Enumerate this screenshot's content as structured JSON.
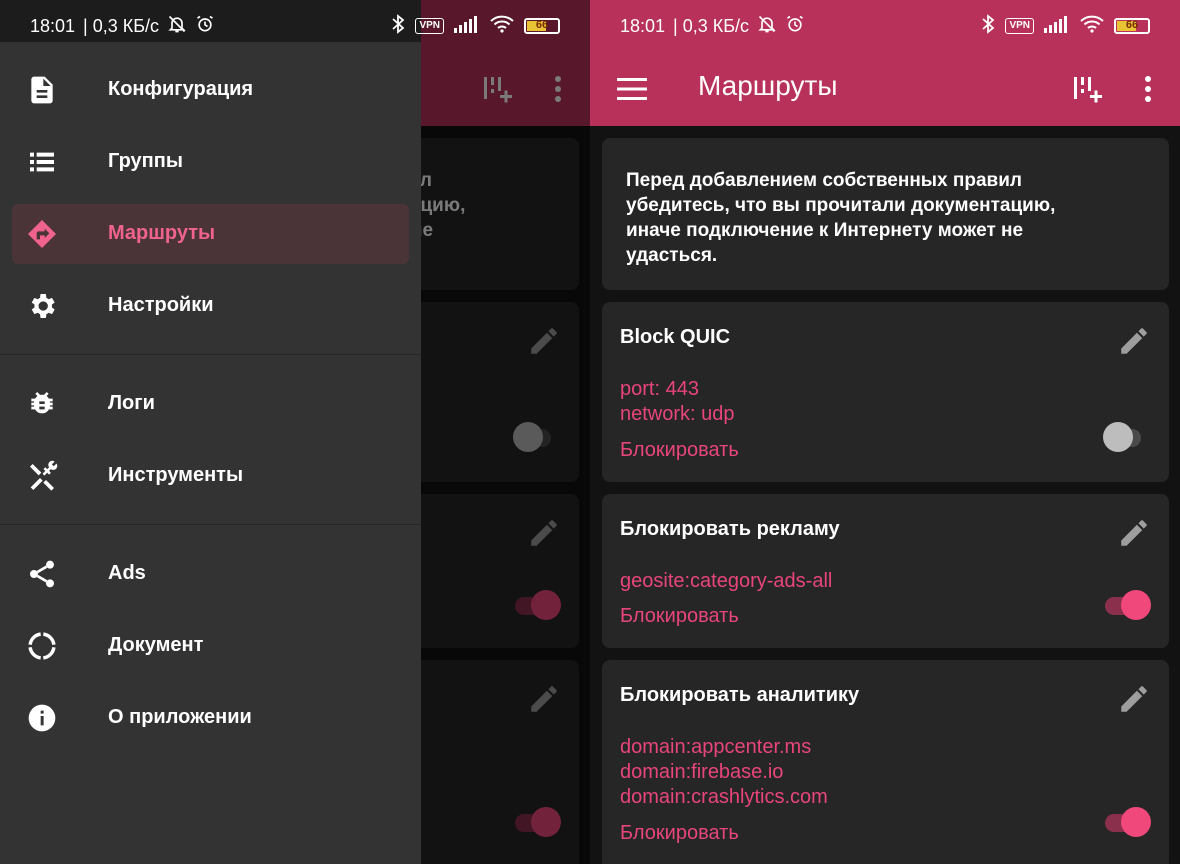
{
  "status_bar": {
    "time": "18:01",
    "speed": "| 0,3 КБ/с",
    "vpn": "VPN",
    "battery": "66"
  },
  "app_bar": {
    "title": "Маршруты",
    "icons": [
      "menu-icon",
      "add-rule-icon",
      "more-vert-icon"
    ],
    "color": "#b8315a"
  },
  "notice": {
    "lines": [
      "Перед добавлением собственных правил",
      "убедитесь, что вы прочитали документацию,",
      "иначе подключение к Интернету может не",
      "удасться."
    ]
  },
  "rules": [
    {
      "name": "Block QUIC",
      "lines": [
        "port: 443",
        "network: udp"
      ],
      "action": "Блокировать",
      "enabled": false
    },
    {
      "name": "Блокировать рекламу",
      "lines": [
        "geosite:category-ads-all"
      ],
      "action": "Блокировать",
      "enabled": true
    },
    {
      "name": "Блокировать аналитику",
      "lines": [
        "domain:appcenter.ms",
        "domain:firebase.io",
        "domain:crashlytics.com"
      ],
      "action": "Блокировать",
      "enabled": true
    }
  ],
  "drawer": {
    "items": [
      {
        "label": "Конфигурация",
        "icon": "document-icon"
      },
      {
        "label": "Группы",
        "icon": "list-icon"
      },
      {
        "label": "Маршруты",
        "icon": "route-icon",
        "active": true
      },
      {
        "label": "Настройки",
        "icon": "gear-icon"
      },
      {
        "label": "Логи",
        "icon": "bug-icon"
      },
      {
        "label": "Инструменты",
        "icon": "tools-icon"
      },
      {
        "label": "Ads",
        "icon": "share-icon"
      },
      {
        "label": "Документ",
        "icon": "loading-icon"
      },
      {
        "label": "О приложении",
        "icon": "info-icon"
      }
    ]
  },
  "colors": {
    "accent": "#e8457a",
    "switch_on": "#f0487b",
    "background": "#121212",
    "card": "#262626",
    "drawer": "#333333"
  }
}
